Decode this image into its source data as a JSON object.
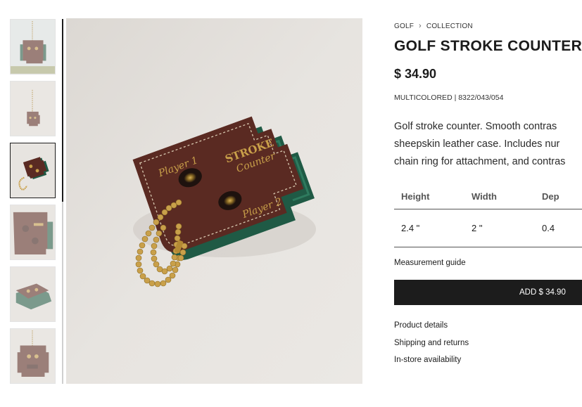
{
  "breadcrumb": {
    "items": [
      "GOLF",
      "COLLECTION"
    ],
    "separator": "›"
  },
  "product": {
    "title": "GOLF STROKE COUNTER",
    "price": "$ 34.90",
    "meta": "MULTICOLORED | 8322/043/054",
    "description_lines": [
      "Golf stroke counter. Smooth contras",
      "sheepskin leather case. Includes nur",
      "chain ring for attachment, and contras"
    ]
  },
  "dimensions": {
    "headers": [
      "Height",
      "Width",
      "Dep"
    ],
    "values": [
      "2.4 \"",
      "2 \"",
      "0.4"
    ]
  },
  "measurement_guide": "Measurement guide",
  "add_button": "ADD $ 34.90",
  "links": [
    "Product details",
    "Shipping and returns",
    "In-store availability"
  ],
  "image_text": {
    "player1": "Player 1",
    "player2": "Player 2",
    "stroke": "STROKE",
    "counter": "Counter"
  },
  "colors": {
    "leather": "#5a2a22",
    "green": "#1f5a45",
    "gold": "#c9a04a",
    "background": "#e7e4e0",
    "button": "#1c1c1c"
  },
  "thumbnails": {
    "count": 6,
    "active_index": 2
  }
}
